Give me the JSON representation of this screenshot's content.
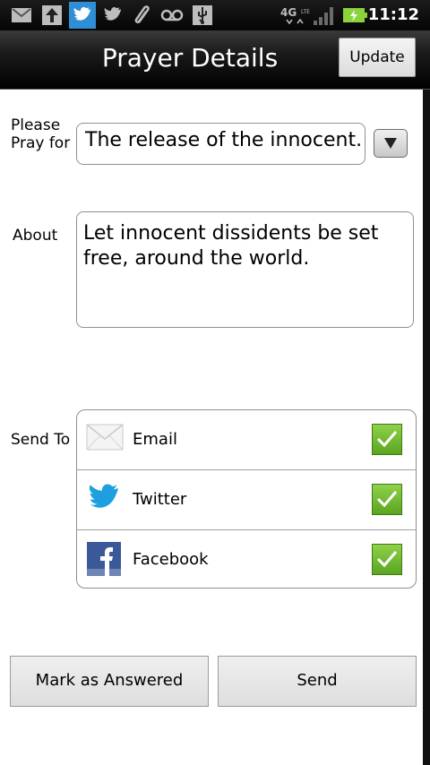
{
  "status_bar": {
    "time": "11:12",
    "network": "4G",
    "icons": [
      "gmail-icon",
      "upload-icon",
      "twitter-notification-icon",
      "twitter-icon",
      "attachment-icon",
      "voicemail-icon",
      "usb-icon",
      "4g-lte-icon",
      "signal-icon",
      "battery-charging-icon"
    ]
  },
  "header": {
    "title": "Prayer Details",
    "update_label": "Update"
  },
  "form": {
    "pray_for_label_line1": "Please",
    "pray_for_label_line2": "Pray for",
    "pray_for_value": "The release of the innocent.",
    "about_label": "About",
    "about_value_line1": "Let innocent dissidents be set",
    "about_value_line2": "free, around the world.",
    "send_to_label": "Send To"
  },
  "send_to": [
    {
      "label": "Email",
      "icon": "email-icon",
      "checked": true
    },
    {
      "label": "Twitter",
      "icon": "twitter-icon",
      "checked": true
    },
    {
      "label": "Facebook",
      "icon": "facebook-icon",
      "checked": true
    }
  ],
  "actions": {
    "mark_answered_label": "Mark as Answered",
    "send_label": "Send"
  },
  "colors": {
    "check_green": "#6ab42c",
    "twitter_blue": "#1d9fe0",
    "facebook_blue": "#3b5998"
  }
}
